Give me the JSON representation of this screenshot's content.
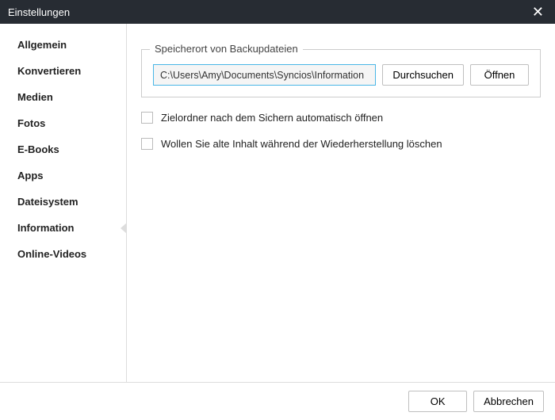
{
  "window": {
    "title": "Einstellungen"
  },
  "sidebar": {
    "items": [
      {
        "label": "Allgemein"
      },
      {
        "label": "Konvertieren"
      },
      {
        "label": "Medien"
      },
      {
        "label": "Fotos"
      },
      {
        "label": "E-Books"
      },
      {
        "label": "Apps"
      },
      {
        "label": "Dateisystem"
      },
      {
        "label": "Information"
      },
      {
        "label": "Online-Videos"
      }
    ],
    "selected_index": 7
  },
  "content": {
    "fieldset_legend": "Speicherort von Backupdateien",
    "path_value": "C:\\Users\\Amy\\Documents\\Syncios\\Information",
    "browse_label": "Durchsuchen",
    "open_label": "Öffnen",
    "checkbox1_label": "Zielordner nach dem Sichern automatisch öffnen",
    "checkbox1_checked": false,
    "checkbox2_label": "Wollen Sie alte Inhalt während der Wiederherstellung löschen",
    "checkbox2_checked": false
  },
  "footer": {
    "ok_label": "OK",
    "cancel_label": "Abbrechen"
  }
}
